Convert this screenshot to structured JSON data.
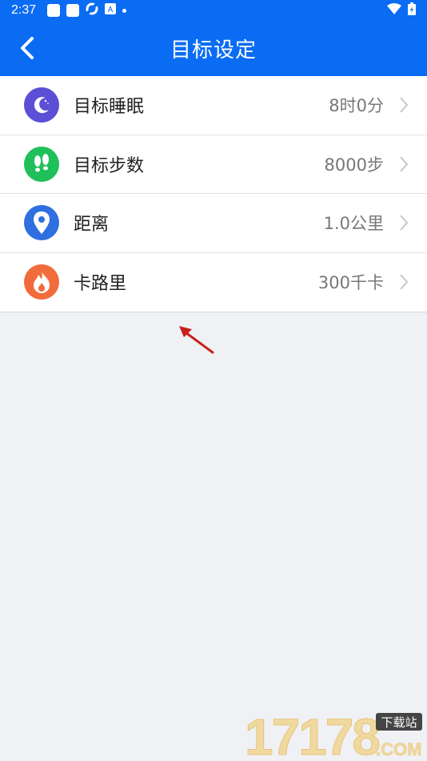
{
  "status_bar": {
    "time": "2:37"
  },
  "header": {
    "title": "目标设定"
  },
  "rows": [
    {
      "label": "目标睡眠",
      "value": "8时0分",
      "icon": "moon-icon",
      "color": "#5b4fd6"
    },
    {
      "label": "目标步数",
      "value": "8000步",
      "icon": "footsteps-icon",
      "color": "#1fc05a"
    },
    {
      "label": "距离",
      "value": "1.0公里",
      "icon": "location-pin-icon",
      "color": "#2f6fe0"
    },
    {
      "label": "卡路里",
      "value": "300千卡",
      "icon": "flame-icon",
      "color": "#f26b3a"
    }
  ],
  "watermark": {
    "brand": "17178",
    "badge": "下载站",
    "suffix": ".COM"
  }
}
